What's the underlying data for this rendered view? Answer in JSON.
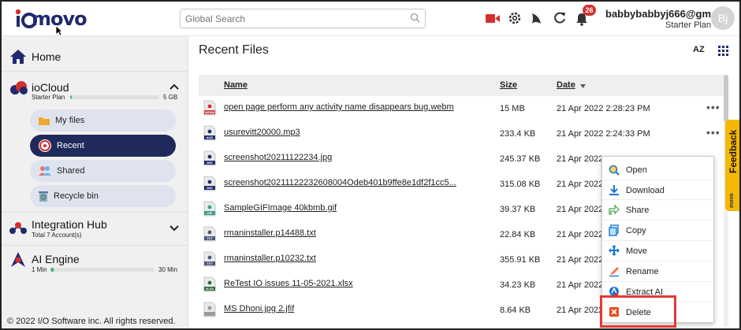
{
  "app": {
    "logo_text": "movo"
  },
  "header": {
    "search_placeholder": "Global Search",
    "notification_count": "26",
    "user_email": "babbybabbyj666@gm...",
    "user_plan": "Starter Plan",
    "avatar_initials": "Bj"
  },
  "sidebar": {
    "home_label": "Home",
    "iocloud": {
      "title": "ioCloud",
      "plan": "Starter Plan",
      "quota": "5 GB",
      "used_fraction": 0.01
    },
    "items": [
      {
        "label": "My files"
      },
      {
        "label": "Recent"
      },
      {
        "label": "Shared"
      },
      {
        "label": "Recycle bin"
      }
    ],
    "integration": {
      "title": "Integration Hub",
      "sub": "Total 7 Account(s)"
    },
    "ai": {
      "title": "AI Engine",
      "start": "1 Min",
      "end": "30 Min",
      "used_fraction": 0.03
    },
    "copyright": "© 2022 I/O Software inc. All rights reserved."
  },
  "main": {
    "title": "Recent Files",
    "sort_label": "AZ",
    "columns": {
      "name": "Name",
      "size": "Size",
      "date": "Date"
    },
    "files": [
      {
        "name": "open page perform any activity name disappears bug.webm",
        "size": "15 MB",
        "date": "21 Apr 2022 2:28:23 PM",
        "type": "WEBM"
      },
      {
        "name": "usurevitt20000.mp3",
        "size": "233.4 KB",
        "date": "21 Apr 2022 2:24:33 PM",
        "type": "AUD"
      },
      {
        "name": "screenshot20211122234.jpg",
        "size": "245.37 KB",
        "date": "21 Apr 2022",
        "type": "IMG"
      },
      {
        "name": "screenshot20211122232608004Odeb401b9ffe8e1df2f1cc5...",
        "size": "315.08 KB",
        "date": "21 Apr 2022",
        "type": "IMG"
      },
      {
        "name": "SampleGIFImage 40kbmb.gif",
        "size": "39.37 KB",
        "date": "21 Apr 2022",
        "type": "GIF"
      },
      {
        "name": "rmaninstaller.p14488.txt",
        "size": "22.84 KB",
        "date": "21 Apr 2022",
        "type": "TXT"
      },
      {
        "name": "rmaninstaller.p10232.txt",
        "size": "355.91 KB",
        "date": "21 Apr 2022",
        "type": "TXT"
      },
      {
        "name": "ReTest IO issues 11-05-2021.xlsx",
        "size": "34.23 KB",
        "date": "21 Apr 2022",
        "type": "XLSX"
      },
      {
        "name": "MS Dhoni.jpg 2.jfif",
        "size": "8.64 KB",
        "date": "21 Apr 2022",
        "type": ""
      }
    ]
  },
  "context_menu": {
    "items": [
      {
        "label": "Open",
        "icon": "open-icon"
      },
      {
        "label": "Download",
        "icon": "download-icon"
      },
      {
        "label": "Share",
        "icon": "share-icon"
      },
      {
        "label": "Copy",
        "icon": "copy-icon"
      },
      {
        "label": "Move",
        "icon": "move-icon"
      },
      {
        "label": "Rename",
        "icon": "rename-icon"
      },
      {
        "label": "Extract AI",
        "icon": "extract-ai-icon"
      },
      {
        "label": "Delete",
        "icon": "delete-icon"
      }
    ]
  },
  "feedback": {
    "label": "Feedback",
    "logo": "movo"
  },
  "colors": {
    "brand_navy": "#1f2a5a",
    "accent_red": "#d32f2f",
    "feedback_yellow": "#f5b800"
  }
}
